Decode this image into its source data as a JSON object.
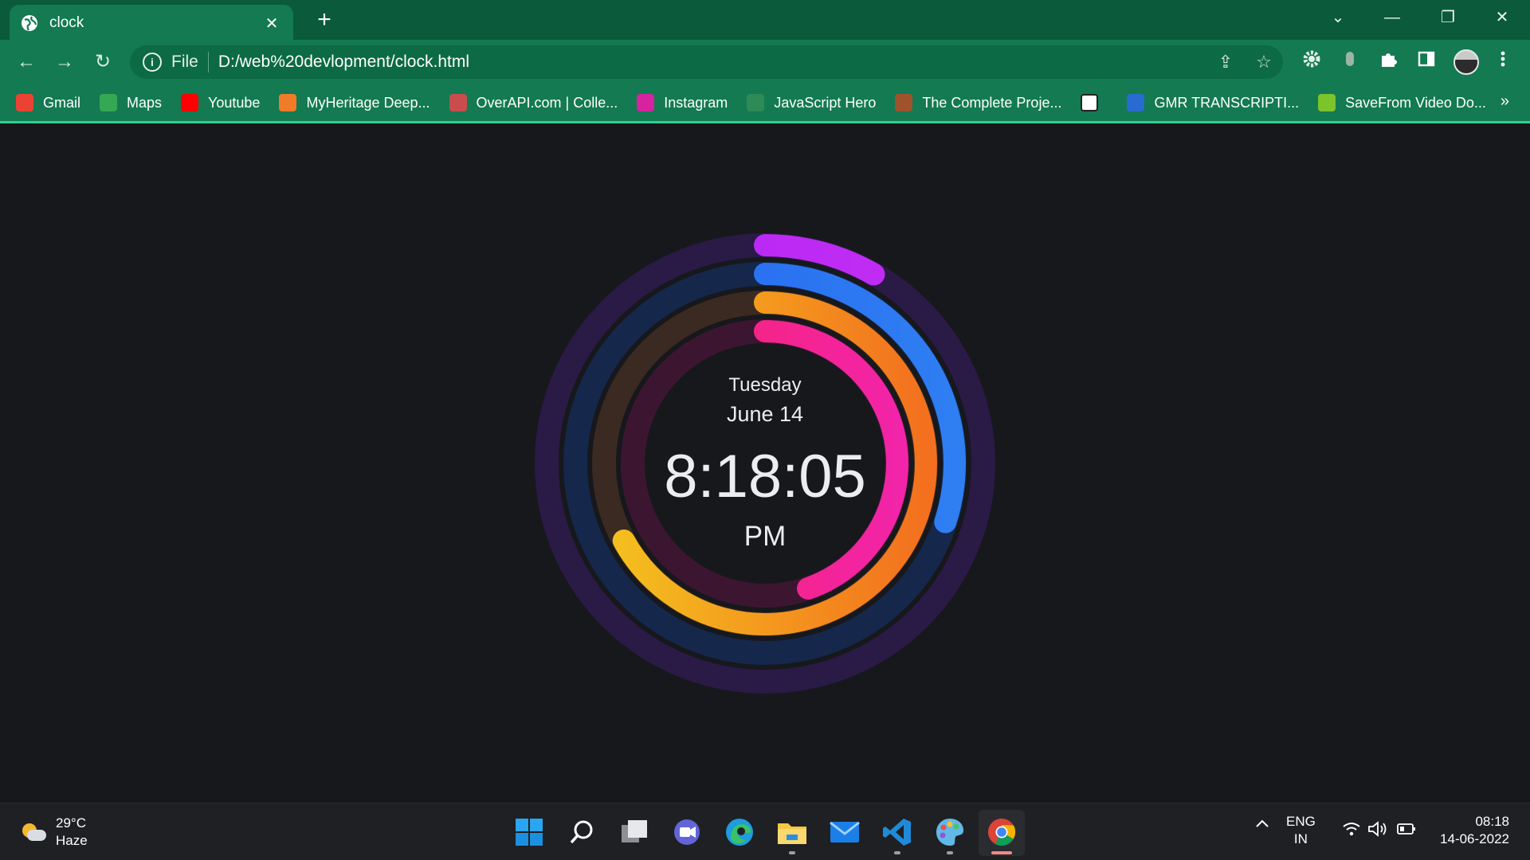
{
  "tab": {
    "title": "clock",
    "close": "✕",
    "new_tab": "+"
  },
  "window_controls": {
    "dropdown": "⌄",
    "minimize": "—",
    "restore": "❐",
    "close": "✕"
  },
  "nav": {
    "back": "←",
    "forward": "→",
    "reload": "↻"
  },
  "omnibox": {
    "scheme_label": "File",
    "url": "D:/web%20devlopment/clock.html",
    "info": "i",
    "share": "⇪",
    "star": "☆"
  },
  "bookmarks": [
    {
      "label": "Gmail",
      "icon": "gmail-icon",
      "color": "#ea4335"
    },
    {
      "label": "Maps",
      "icon": "maps-pin-icon",
      "color": "#34a853"
    },
    {
      "label": "Youtube",
      "icon": "youtube-icon",
      "color": "#ff0000"
    },
    {
      "label": "MyHeritage Deep...",
      "icon": "myheritage-icon",
      "color": "#f07b28"
    },
    {
      "label": "OverAPI.com | Colle...",
      "icon": "overapi-icon",
      "color": "#c94d4d"
    },
    {
      "label": "Instagram",
      "icon": "instagram-icon",
      "color": "#d6249f"
    },
    {
      "label": "JavaScript Hero",
      "icon": "js-hero-icon",
      "color": "#2e8b57"
    },
    {
      "label": "The Complete Proje...",
      "icon": "project-icon",
      "color": "#a0522d"
    },
    {
      "label": "",
      "icon": "museum-icon",
      "color": "#ffffff"
    },
    {
      "label": "GMR TRANSCRIPTI...",
      "icon": "gmr-icon",
      "color": "#2a6bd1"
    },
    {
      "label": "SaveFrom Video Do...",
      "icon": "savefrom-icon",
      "color": "#7bc42c"
    }
  ],
  "bookmarks_more": "»",
  "clock": {
    "day": "Tuesday",
    "date": "June 14",
    "time": "8:18:05",
    "ampm": "PM",
    "rings": [
      {
        "name": "seconds",
        "fraction": 0.083,
        "color_a": "#b223f6",
        "color_b": "#c42ff2",
        "track": "#2a1a46"
      },
      {
        "name": "minutes",
        "fraction": 0.3,
        "color_a": "#2566f0",
        "color_b": "#2f7ef2",
        "track": "#15274a"
      },
      {
        "name": "hours",
        "fraction": 0.67,
        "color_a": "#f4c21e",
        "color_b": "#f3701e",
        "track": "#3b2a22"
      },
      {
        "name": "days",
        "fraction": 0.447,
        "color_a": "#f7246d",
        "color_b": "#f224a8",
        "track": "#3c1631"
      }
    ]
  },
  "taskbar": {
    "weather_temp": "29°C",
    "weather_desc": "Haze",
    "language_top": "ENG",
    "language_bottom": "IN",
    "clock_time": "08:18",
    "clock_date": "14-06-2022",
    "chevron": "^"
  }
}
